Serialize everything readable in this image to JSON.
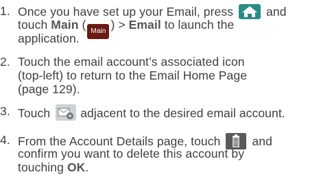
{
  "steps": [
    {
      "num": "1.",
      "l1_pre": "Once you have set up your Email, press",
      "l1_post": "and",
      "l2_pre": "touch",
      "l2_bold1": "Main",
      "l2_mid": " (",
      "main_icon_label": "Main",
      "l2_close": ")",
      "l2_arrow": " > ",
      "l2_bold2": "Email",
      "l2_post": " to launch the",
      "l3": "application."
    },
    {
      "num": "2.",
      "l1": "Touch the email account’s associated icon",
      "l2": "(top-left) to return to the Email Home Page",
      "l3": "(page 129)."
    },
    {
      "num": "3.",
      "l1_pre": "Touch",
      "l1_post": "adjacent to the desired email account."
    },
    {
      "num": "4.",
      "l1_pre": "From the Account Details page, touch",
      "l1_post": "and",
      "l2": "confirm you want to delete this account by",
      "l3_pre": "touching ",
      "l3_bold": "OK",
      "l3_post": "."
    }
  ],
  "icons": {
    "home": "home-icon",
    "main": "main-apps-icon",
    "account_settings": "account-settings-icon",
    "trash": "trash-icon"
  },
  "colors": {
    "text": "#3f3f3f",
    "home_icon_bg": "#2a8c84",
    "main_icon_bg": "#6b1a12",
    "trash_icon_bg": "#5a5a5a"
  }
}
